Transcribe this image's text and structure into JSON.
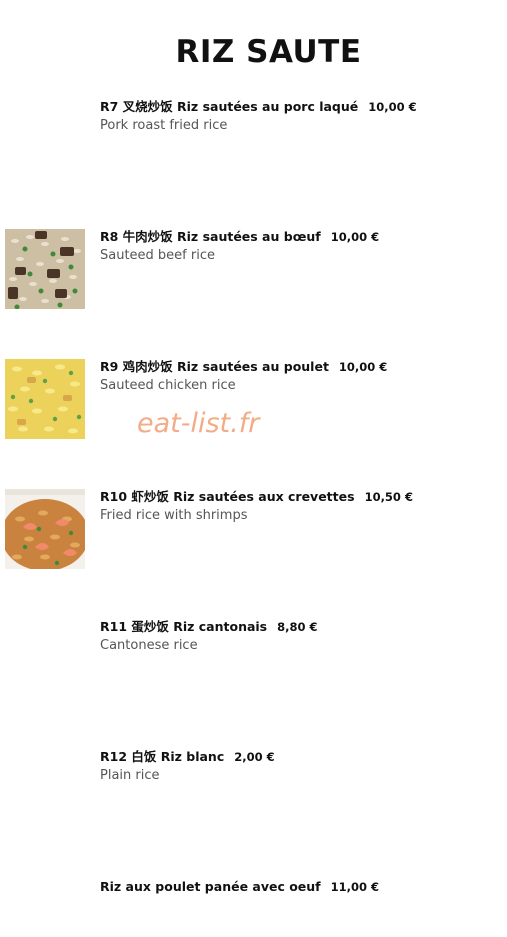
{
  "page": {
    "title": "RIZ SAUTE",
    "watermark": "eat-list.fr"
  },
  "items": [
    {
      "name": "R7 叉烧炒饭 Riz sautées au porc laqué",
      "price": "10,00 €",
      "description": "Pork roast fried rice",
      "image": null
    },
    {
      "name": "R8 牛肉炒饭 Riz sautées au bœuf",
      "price": "10,00 €",
      "description": "Sauteed beef rice",
      "image": "beef-fried-rice-photo"
    },
    {
      "name": "R9 鸡肉炒饭 Riz sautées au poulet",
      "price": "10,00 €",
      "description": "Sauteed chicken rice",
      "image": "chicken-fried-rice-photo"
    },
    {
      "name": "R10 虾炒饭 Riz sautées aux crevettes",
      "price": "10,50 €",
      "description": "Fried rice with shrimps",
      "image": "shrimp-fried-rice-photo"
    },
    {
      "name": "R11 蛋炒饭 Riz cantonais",
      "price": "8,80 €",
      "description": "Cantonese rice",
      "image": null
    },
    {
      "name": "R12 白饭 Riz blanc",
      "price": "2,00 €",
      "description": "Plain rice",
      "image": null
    },
    {
      "name": "Riz aux poulet panée avec oeuf",
      "price": "11,00 €",
      "description": "",
      "image": null
    }
  ]
}
